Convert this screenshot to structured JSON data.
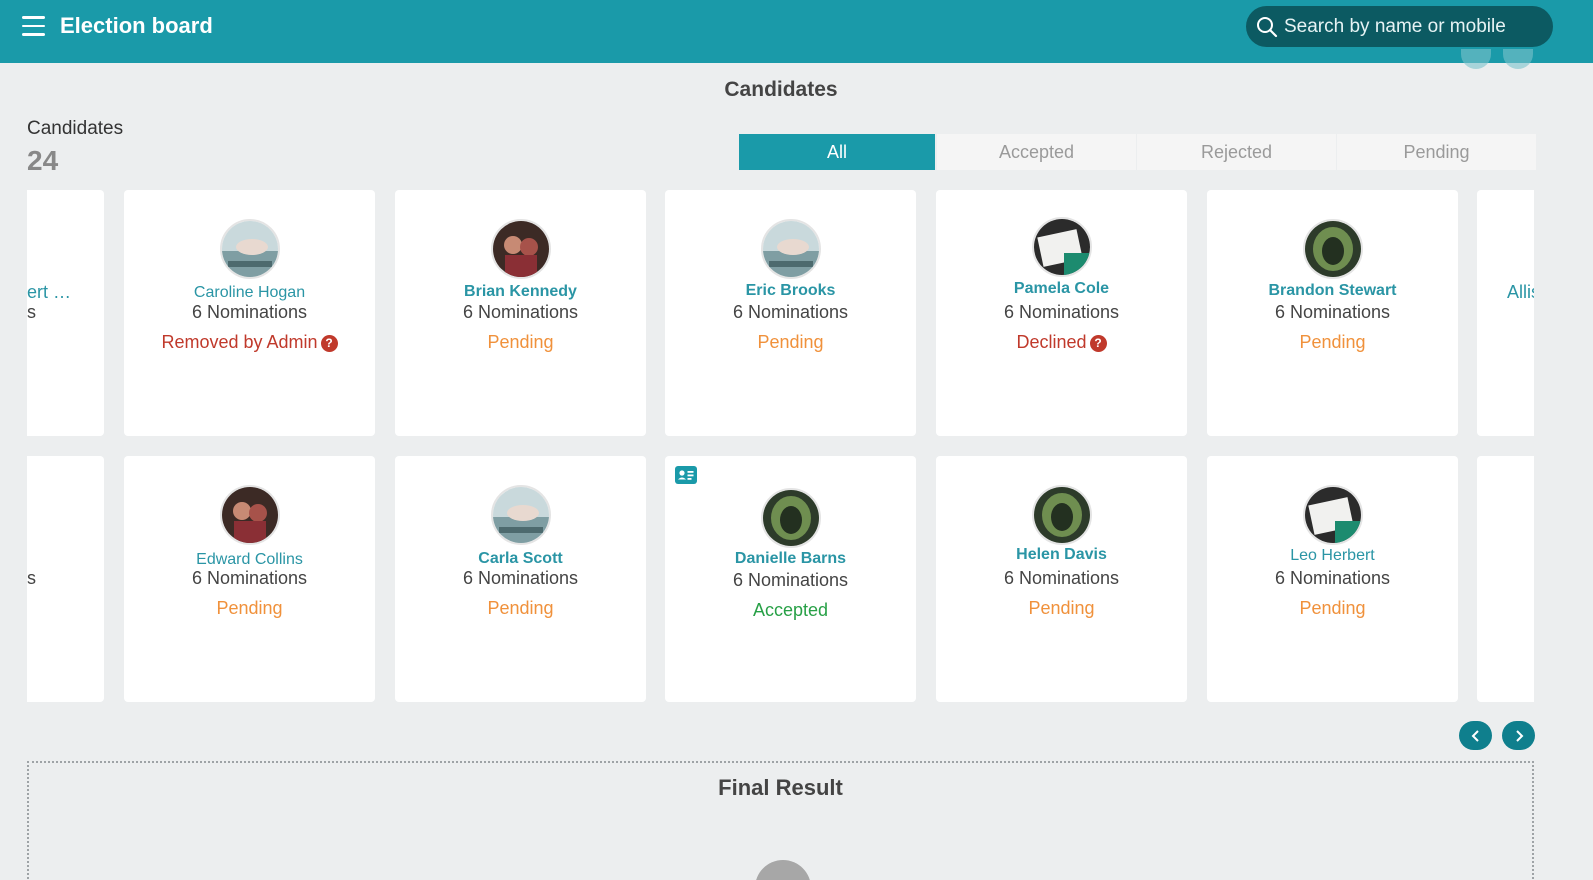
{
  "app": {
    "title": "Election board"
  },
  "search": {
    "placeholder": "Search by name or mobile"
  },
  "page": {
    "title": "Candidates"
  },
  "summary": {
    "label": "Candidates",
    "count": "24"
  },
  "tabs": [
    {
      "label": "All",
      "active": true
    },
    {
      "label": "Accepted",
      "active": false
    },
    {
      "label": "Rejected",
      "active": false
    },
    {
      "label": "Pending",
      "active": false
    }
  ],
  "partial_cards": {
    "left_top_name": "ert …",
    "left_top_sub": "s",
    "left_bottom_sub": "s",
    "right_top_name": "Allis"
  },
  "candidates_row1": [
    {
      "name": "Caroline Hogan",
      "nominations": "6 Nominations",
      "status": "Removed by Admin",
      "status_type": "removed",
      "help": true
    },
    {
      "name": "Brian Kennedy",
      "nominations": "6 Nominations",
      "status": "Pending",
      "status_type": "pending"
    },
    {
      "name": "Eric Brooks",
      "nominations": "6 Nominations",
      "status": "Pending",
      "status_type": "pending"
    },
    {
      "name": "Pamela Cole",
      "nominations": "6 Nominations",
      "status": "Declined",
      "status_type": "declined",
      "help": true
    },
    {
      "name": "Brandon Stewart",
      "nominations": "6 Nominations",
      "status": "Pending",
      "status_type": "pending"
    }
  ],
  "candidates_row2": [
    {
      "name": "Edward Collins",
      "nominations": "6 Nominations",
      "status": "Pending",
      "status_type": "pending"
    },
    {
      "name": "Carla Scott",
      "nominations": "6 Nominations",
      "status": "Pending",
      "status_type": "pending"
    },
    {
      "name": "Danielle Barns",
      "nominations": "6 Nominations",
      "status": "Accepted",
      "status_type": "accepted",
      "id_badge": true
    },
    {
      "name": "Helen Davis",
      "nominations": "6 Nominations",
      "status": "Pending",
      "status_type": "pending"
    },
    {
      "name": "Leo Herbert",
      "nominations": "6 Nominations",
      "status": "Pending",
      "status_type": "pending"
    }
  ],
  "icons": {
    "menu": "hamburger-icon",
    "search": "search-icon",
    "help": "question-circle-icon",
    "id": "id-card-icon",
    "prev": "chevron-left-icon",
    "next": "chevron-right-icon"
  },
  "help_glyph": "?",
  "final_result": {
    "title": "Final Result"
  },
  "colors": {
    "primary": "#1a9aa9",
    "pending": "#f0913b",
    "declined": "#c0392b",
    "accepted": "#27a046"
  }
}
